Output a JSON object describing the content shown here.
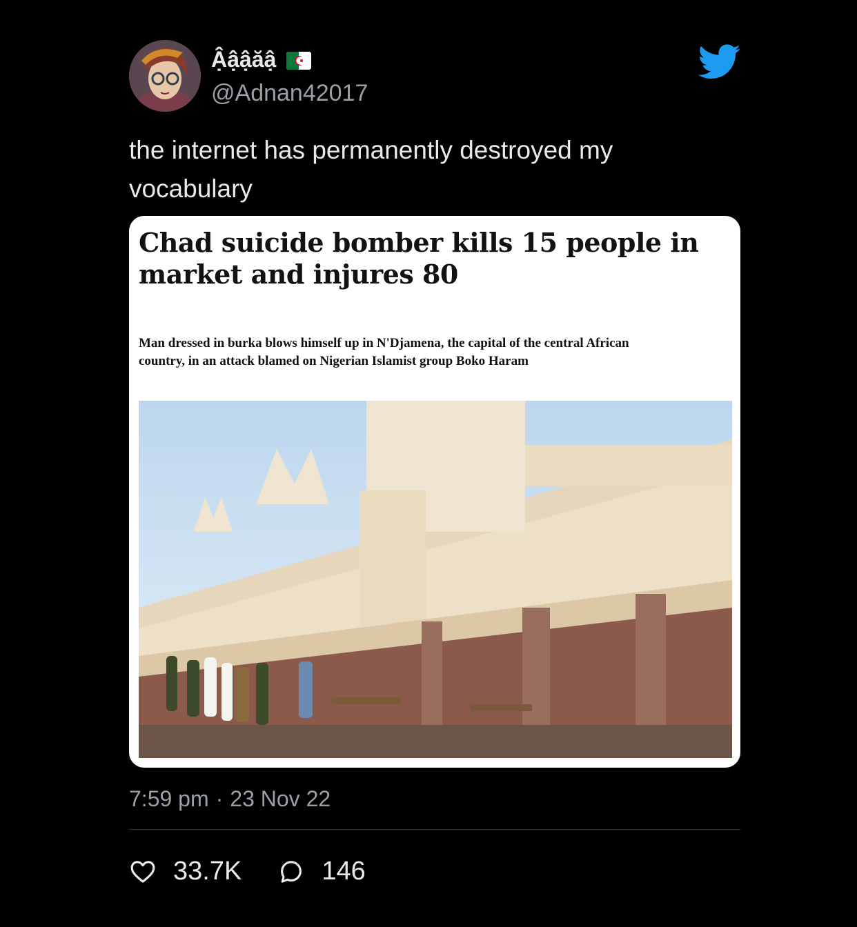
{
  "author": {
    "display_name": "Ậậậăậ",
    "handle": "@Adnan42017",
    "flag_icon": "algeria-flag-icon",
    "avatar_icon": "anime-avatar"
  },
  "brand": {
    "icon": "twitter-bird-icon",
    "color": "#1d9bf0"
  },
  "tweet": {
    "text": "the internet has permanently destroyed my vocabulary",
    "time": "7:59 pm",
    "separator": "·",
    "date": "23 Nov 22"
  },
  "article": {
    "headline": "Chad suicide bomber kills 15 people in market and injures 80",
    "standfirst": "Man dressed in burka blows himself up in N'Djamena, the capital of the central African country, in an attack blamed on Nigerian Islamist group Boko Haram",
    "image_icon": "market-building-photo"
  },
  "metrics": {
    "likes": "33.7K",
    "replies": "146",
    "like_icon": "heart-icon",
    "reply_icon": "reply-bubble-icon"
  }
}
